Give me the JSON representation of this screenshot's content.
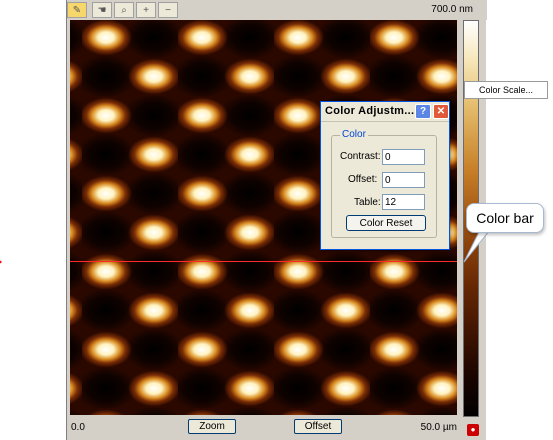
{
  "toolbar": {
    "tools": [
      {
        "name": "pencil-icon"
      },
      {
        "name": "hand-icon"
      },
      {
        "name": "zoom-icon"
      },
      {
        "name": "zoom-in-icon"
      },
      {
        "name": "zoom-out-icon"
      }
    ],
    "scale_max": "700.0 nm"
  },
  "axis": {
    "x_start": "0.0",
    "x_end": "50.0 µm"
  },
  "buttons": {
    "zoom": "Zoom",
    "offset": "Offset"
  },
  "dialog": {
    "title": "Color Adjustm...",
    "help": "?",
    "close": "✕",
    "group_label": "Color",
    "contrast_label": "Contrast:",
    "contrast_value": "0",
    "offset_label": "Offset:",
    "offset_value": "0",
    "table_label": "Table:",
    "table_value": "12",
    "reset_label": "Color Reset"
  },
  "context_menu": {
    "item": "Color Scale..."
  },
  "callout": {
    "text": "Color bar"
  },
  "colors": {
    "line": "#ff2a2a",
    "dialog_border": "#0054e3"
  }
}
